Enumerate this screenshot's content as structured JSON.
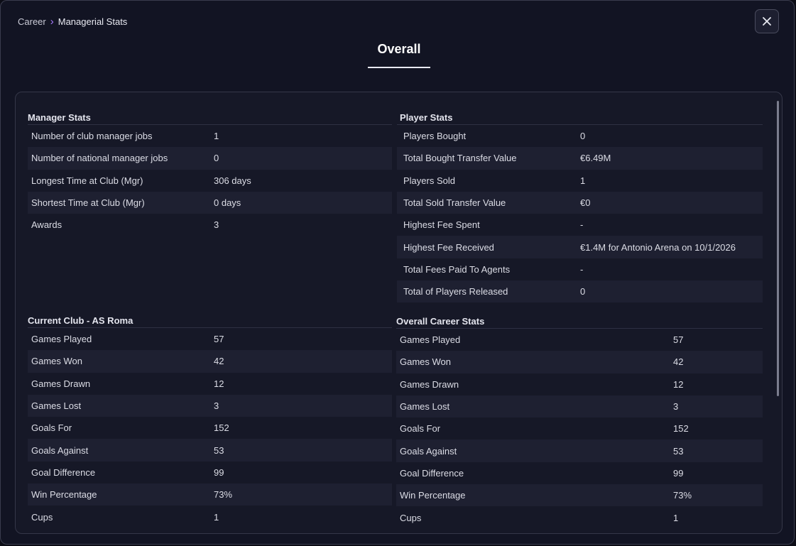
{
  "breadcrumb": {
    "parent": "Career",
    "current": "Managerial Stats"
  },
  "tab": {
    "title": "Overall"
  },
  "manager_stats": {
    "title": "Manager Stats",
    "rows": [
      {
        "label": "Number of club manager jobs",
        "value": "1"
      },
      {
        "label": "Number of national manager jobs",
        "value": "0"
      },
      {
        "label": "Longest Time at Club (Mgr)",
        "value": "306 days"
      },
      {
        "label": "Shortest Time at Club (Mgr)",
        "value": "0 days"
      },
      {
        "label": "Awards",
        "value": "3"
      }
    ]
  },
  "player_stats": {
    "title": "Player Stats",
    "rows": [
      {
        "label": "Players Bought",
        "value": "0"
      },
      {
        "label": "Total Bought Transfer Value",
        "value": "€6.49M"
      },
      {
        "label": "Players Sold",
        "value": "1"
      },
      {
        "label": "Total Sold Transfer Value",
        "value": "€0"
      },
      {
        "label": "Highest Fee Spent",
        "value": "-"
      },
      {
        "label": "Highest Fee Received",
        "value": "€1.4M for Antonio Arena on 10/1/2026"
      },
      {
        "label": "Total Fees Paid To Agents",
        "value": "-"
      },
      {
        "label": "Total of Players Released",
        "value": "0"
      }
    ]
  },
  "current_club": {
    "title": "Current Club - AS Roma",
    "rows": [
      {
        "label": "Games Played",
        "value": "57"
      },
      {
        "label": "Games Won",
        "value": "42"
      },
      {
        "label": "Games Drawn",
        "value": "12"
      },
      {
        "label": "Games Lost",
        "value": "3"
      },
      {
        "label": "Goals For",
        "value": "152"
      },
      {
        "label": "Goals Against",
        "value": "53"
      },
      {
        "label": "Goal Difference",
        "value": "99"
      },
      {
        "label": "Win Percentage",
        "value": "73%"
      },
      {
        "label": "Cups",
        "value": "1"
      }
    ]
  },
  "overall_career": {
    "title": "Overall Career Stats",
    "rows": [
      {
        "label": "Games Played",
        "value": "57"
      },
      {
        "label": "Games Won",
        "value": "42"
      },
      {
        "label": "Games Drawn",
        "value": "12"
      },
      {
        "label": "Games Lost",
        "value": "3"
      },
      {
        "label": "Goals For",
        "value": "152"
      },
      {
        "label": "Goals Against",
        "value": "53"
      },
      {
        "label": "Goal Difference",
        "value": "99"
      },
      {
        "label": "Win Percentage",
        "value": "73%"
      },
      {
        "label": "Cups",
        "value": "1"
      }
    ]
  },
  "icons": {
    "close": "close-icon",
    "breadcrumb_separator": "chevron-right-icon"
  },
  "colors": {
    "accent": "#a77bff",
    "background": "#121423",
    "panel": "#161827",
    "row_alt": "#1e2031"
  }
}
